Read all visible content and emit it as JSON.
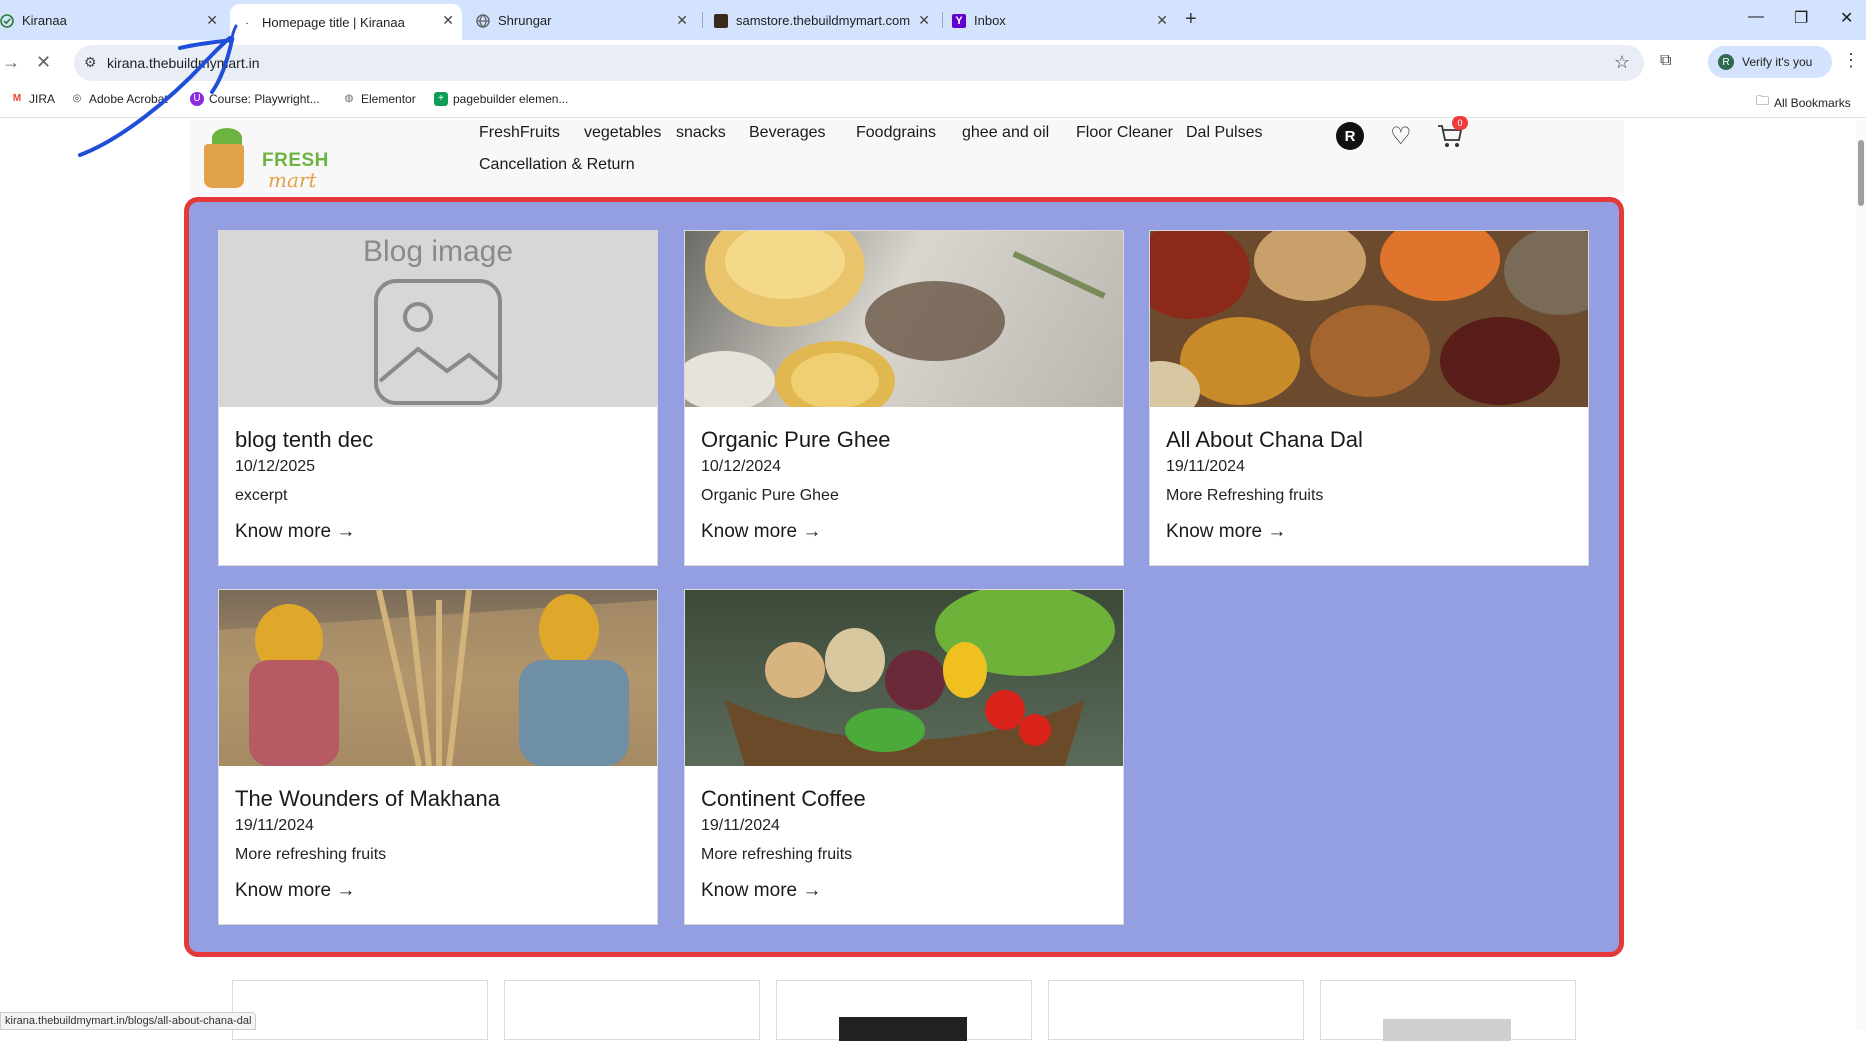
{
  "browser": {
    "tabs": [
      {
        "title": "Kiranaa",
        "favicon": "check-circle-icon",
        "active": false
      },
      {
        "title": "Homepage title | Kiranaa",
        "favicon": "loading-dot-icon",
        "active": true
      },
      {
        "title": "Shrungar",
        "favicon": "globe-icon",
        "active": false
      },
      {
        "title": "samstore.thebuildmymart.com",
        "favicon": "store-image-icon",
        "active": false
      },
      {
        "title": "Inbox",
        "favicon": "yahoo-mail-icon",
        "active": false
      }
    ],
    "url": "kirana.thebuildmymart.in",
    "verify_label": "Verify it's you",
    "verify_avatar": "R",
    "bookmarks": [
      {
        "label": "JIRA",
        "icon": "gmail-icon"
      },
      {
        "label": "Adobe Acrobat",
        "icon": "acrobat-icon"
      },
      {
        "label": "Course: Playwright...",
        "icon": "udemy-icon"
      },
      {
        "label": "Elementor",
        "icon": "globe-icon"
      },
      {
        "label": "pagebuilder elemen...",
        "icon": "sheets-icon"
      }
    ],
    "all_bookmarks_label": "All Bookmarks",
    "status_url": "kirana.thebuildmymart.in/blogs/all-about-chana-dal"
  },
  "site": {
    "logo": {
      "line1": "FRESH",
      "line2": "mart"
    },
    "nav": [
      "FreshFruits",
      "vegetables",
      "snacks",
      "Beverages",
      "Foodgrains",
      "ghee and oil",
      "Floor Cleaner",
      "Dal Pulses",
      "Cancellation & Return"
    ],
    "user_initial": "R",
    "cart_count": "0"
  },
  "blogs": [
    {
      "title": "blog tenth dec",
      "date": "10/12/2025",
      "excerpt": "excerpt",
      "link": "Know more →",
      "image": "placeholder",
      "placeholder_label": "Blog image"
    },
    {
      "title": "Organic Pure Ghee",
      "date": "10/12/2024",
      "excerpt": "Organic Pure Ghee",
      "link": "Know more →",
      "image": "ghee"
    },
    {
      "title": "All About Chana Dal",
      "date": "19/11/2024",
      "excerpt": "More Refreshing fruits",
      "link": "Know more →",
      "image": "lentils"
    },
    {
      "title": "The Wounders of Makhana",
      "date": "19/11/2024",
      "excerpt": "More refreshing fruits",
      "link": "Know more →",
      "image": "harvest"
    },
    {
      "title": "Continent Coffee",
      "date": "19/11/2024",
      "excerpt": "More refreshing fruits",
      "link": "Know more →",
      "image": "vegetables"
    }
  ],
  "colors": {
    "panel_bg": "#949fe2",
    "panel_border": "#e5383b",
    "tabbar": "#d3e3fd",
    "annotation_pen": "#1f4fd8"
  }
}
